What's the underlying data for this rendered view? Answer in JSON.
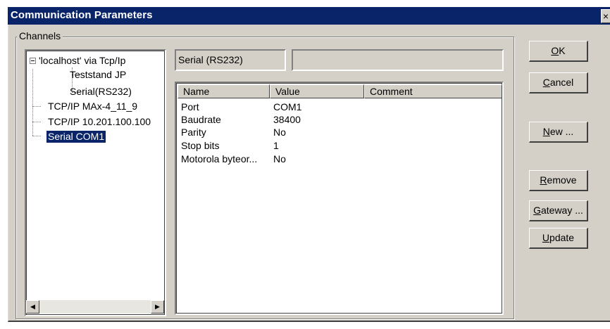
{
  "window": {
    "title": "Communication Parameters",
    "close_glyph": "×"
  },
  "channels": {
    "group_label": "Channels",
    "tree": [
      {
        "label": "'localhost' via Tcp/Ip"
      },
      {
        "label": "Teststand JP"
      },
      {
        "label": "Serial(RS232)"
      },
      {
        "label": "TCP/IP MAx-4_11_9"
      },
      {
        "label": "TCP/IP 10.201.100.100"
      },
      {
        "label": "Serial COM1"
      }
    ],
    "selected": "Serial COM1"
  },
  "device": {
    "type": "Serial (RS232)",
    "info": ""
  },
  "params": {
    "headers": [
      "Name",
      "Value",
      "Comment"
    ],
    "rows": [
      {
        "name": "Port",
        "value": "COM1",
        "comment": ""
      },
      {
        "name": "Baudrate",
        "value": "38400",
        "comment": ""
      },
      {
        "name": "Parity",
        "value": "No",
        "comment": ""
      },
      {
        "name": "Stop bits",
        "value": "1",
        "comment": ""
      },
      {
        "name": "Motorola byteor...",
        "value": "No",
        "comment": ""
      }
    ]
  },
  "buttons": {
    "ok": {
      "mnemonic": "O",
      "rest": "K"
    },
    "cancel": {
      "mnemonic": "C",
      "rest": "ancel"
    },
    "new": {
      "mnemonic": "N",
      "rest": "ew ..."
    },
    "remove": {
      "mnemonic": "R",
      "rest": "emove"
    },
    "gateway": {
      "mnemonic": "G",
      "rest": "ateway ..."
    },
    "update": {
      "mnemonic": "U",
      "rest": "pdate"
    }
  },
  "icons": {
    "expander": "minus-box-icon",
    "scroll_left": "arrow-left-icon",
    "scroll_right": "arrow-right-icon",
    "close": "close-icon"
  },
  "colors": {
    "titlebar": "#0a246a",
    "face": "#d4d0c8",
    "selection": "#0a246a"
  }
}
